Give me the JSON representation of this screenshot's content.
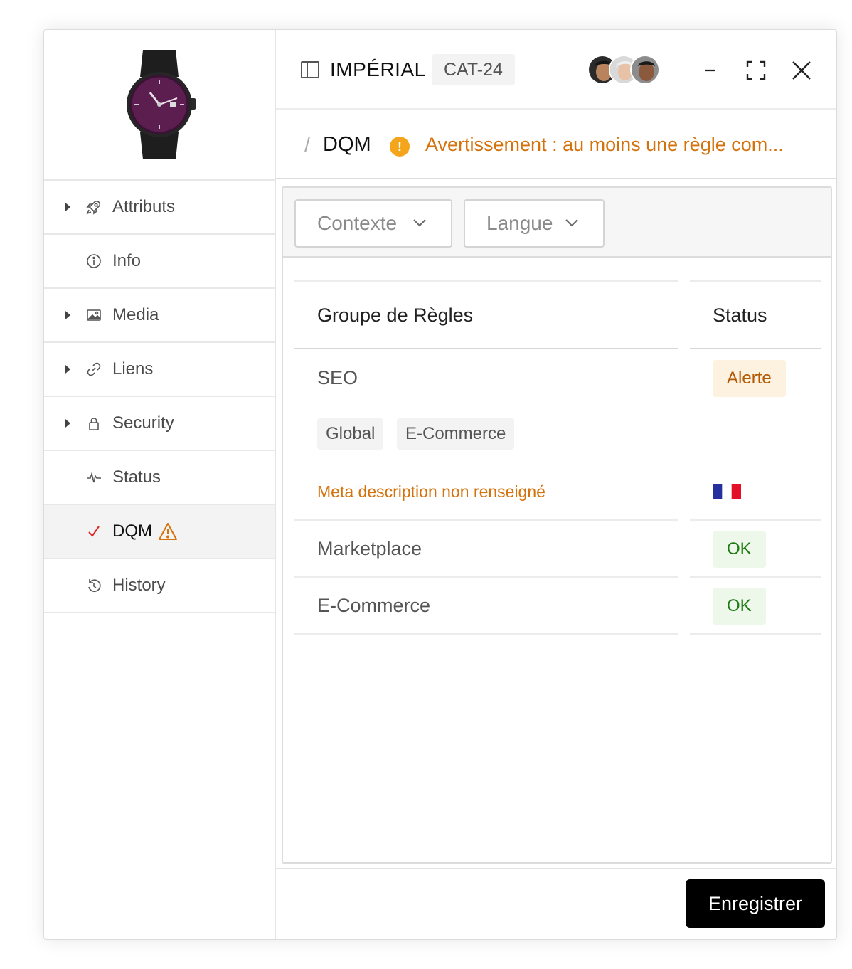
{
  "sidebar": {
    "items": [
      {
        "label": "Attributs",
        "icon": "rocket-icon",
        "expandable": true
      },
      {
        "label": "Info",
        "icon": "info-icon",
        "expandable": false
      },
      {
        "label": "Media",
        "icon": "image-icon",
        "expandable": true
      },
      {
        "label": "Liens",
        "icon": "link-icon",
        "expandable": true
      },
      {
        "label": "Security",
        "icon": "lock-icon",
        "expandable": true
      },
      {
        "label": "Status",
        "icon": "pulse-icon",
        "expandable": false
      },
      {
        "label": "DQM",
        "icon": "check-icon",
        "expandable": false,
        "active": true,
        "warning": true
      },
      {
        "label": "History",
        "icon": "history-icon",
        "expandable": false
      }
    ]
  },
  "header": {
    "title": "IMPÉRIAL",
    "code": "CAT-24",
    "avatars": [
      "avatar-user-1",
      "avatar-user-2",
      "avatar-user-3"
    ]
  },
  "breadcrumb": {
    "separator": "/",
    "current": "DQM",
    "warning_icon": "!",
    "warning_text": "Avertissement : au moins une règle com..."
  },
  "filters": {
    "context_label": "Contexte",
    "language_label": "Langue"
  },
  "table": {
    "headers": {
      "group": "Groupe de Règles",
      "status": "Status"
    },
    "rows": [
      {
        "name": "SEO",
        "status": "Alerte",
        "tags": [
          "Global",
          "E-Commerce"
        ],
        "rule": "Meta description non renseigné",
        "flag": "flag-fr"
      },
      {
        "name": "Marketplace",
        "status": "OK"
      },
      {
        "name": "E-Commerce",
        "status": "OK"
      }
    ]
  },
  "footer": {
    "save_label": "Enregistrer"
  },
  "colors": {
    "warning": "#d4720c",
    "warning_dot": "#f4a51c",
    "alert_bg": "#fdf1e0",
    "ok_bg": "#eef8ea",
    "ok_text": "#1e7b14",
    "active_check": "#e02424"
  }
}
